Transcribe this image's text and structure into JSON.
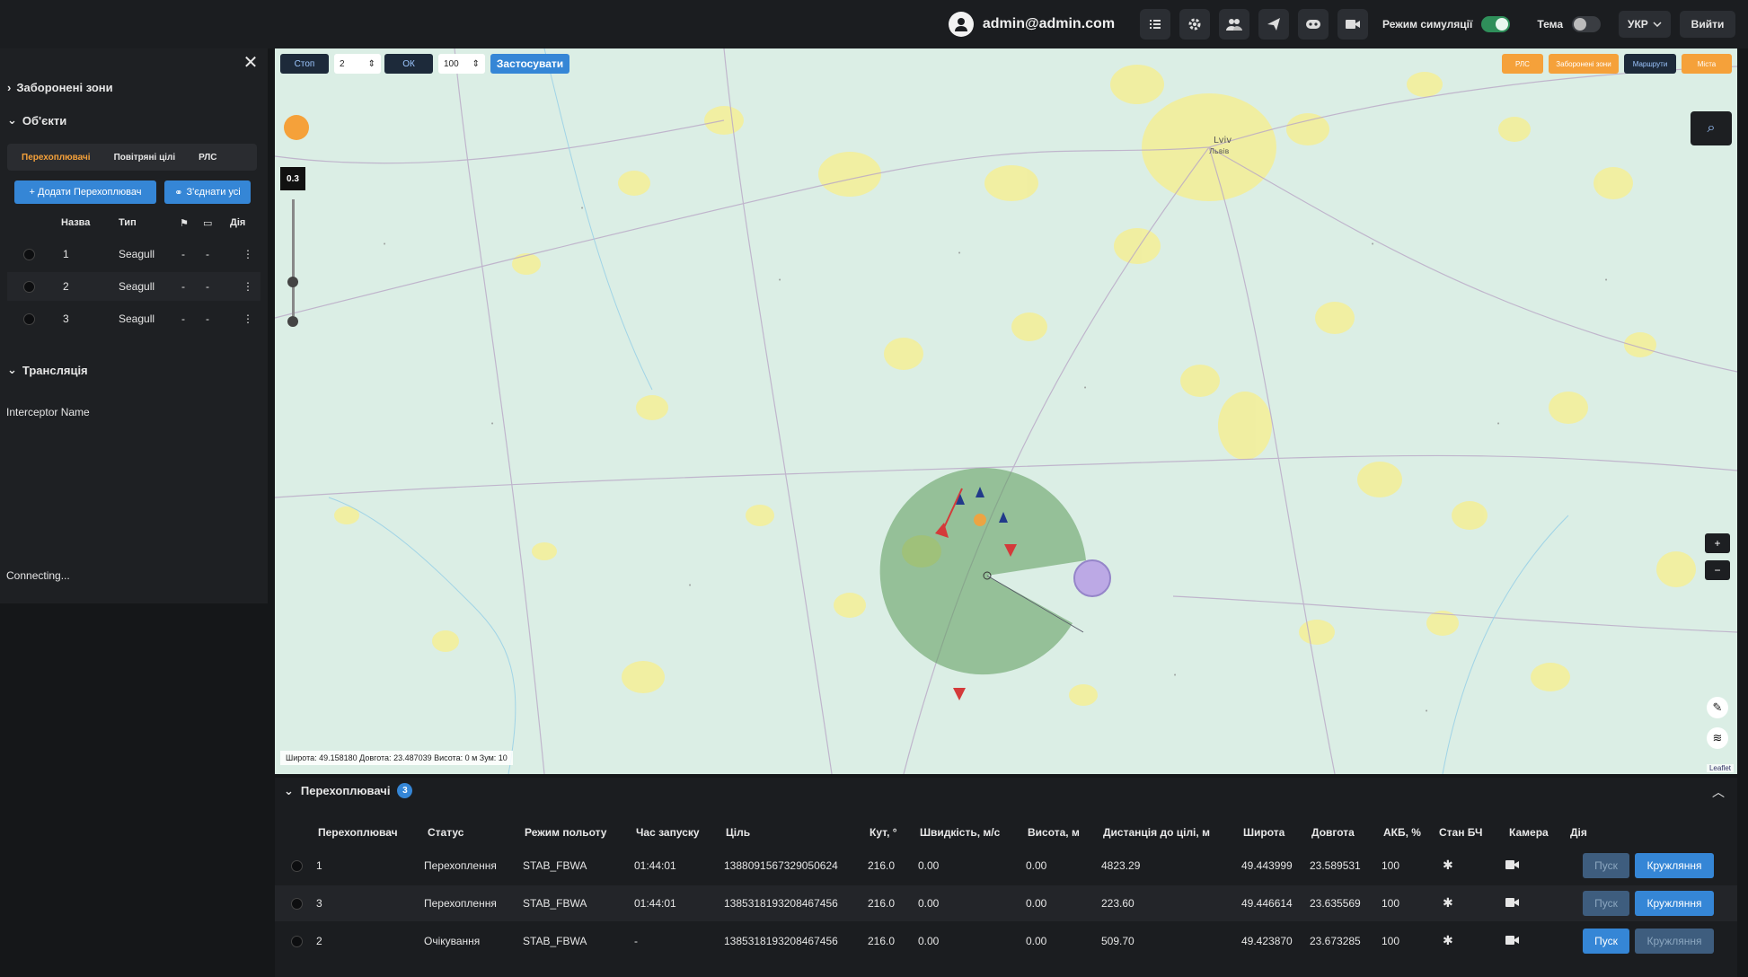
{
  "topbar": {
    "user": "admin@admin.com",
    "sim_label": "Режим симуляції",
    "theme_label": "Тема",
    "lang": "УКР",
    "logout": "Вийти"
  },
  "sidebar": {
    "sections": {
      "restricted": "Заборонені зони",
      "objects": "Об'єкти",
      "broadcast": "Трансляція"
    },
    "tabs": [
      "Перехоплювачі",
      "Повітряні цілі",
      "РЛС"
    ],
    "add_btn": "+ Додати Перехоплювач",
    "connect_btn": "З'єднати усі",
    "columns": {
      "name": "Назва",
      "type": "Тип",
      "action": "Дія"
    },
    "rows": [
      {
        "name": "1",
        "type": "Seagull",
        "c1": "-",
        "c2": "-"
      },
      {
        "name": "2",
        "type": "Seagull",
        "c1": "-",
        "c2": "-"
      },
      {
        "name": "3",
        "type": "Seagull",
        "c1": "-",
        "c2": "-"
      }
    ],
    "interceptor_name": "Interceptor Name",
    "connecting": "Connecting..."
  },
  "map": {
    "controls": {
      "stop": "Стоп",
      "speed_value": "2",
      "ok": "ОК",
      "scale_value": "100",
      "apply": "Застосувати"
    },
    "layers": [
      "РЛС",
      "Заборонені зони",
      "Маршрути",
      "Міста"
    ],
    "zoom_value": "0.3",
    "coords": "Широта: 49.158180  Довгота: 23.487039  Висота: 0 м  Зум: 10",
    "city_label": "Lviv\nЛьвів",
    "attribution": "Leaflet"
  },
  "bottom": {
    "title": "Перехоплювачі",
    "count": "3",
    "columns": [
      "Перехоплювач",
      "Статус",
      "Режим польоту",
      "Час запуску",
      "Ціль",
      "Кут, °",
      "Швидкість, м/с",
      "Висота, м",
      "Дистанція до цілі, м",
      "Широта",
      "Довгота",
      "АКБ, %",
      "Стан БЧ",
      "Камера",
      "Дія"
    ],
    "rows": [
      {
        "id": "1",
        "status": "Перехоплення",
        "mode": "STAB_FBWA",
        "launch": "01:44:01",
        "target": "1388091567329050624",
        "angle": "216.0",
        "speed": "0.00",
        "alt": "0.00",
        "dist": "4823.29",
        "lat": "49.443999",
        "lon": "23.589531",
        "bat": "100",
        "start": "Пуск",
        "loiter": "Кружляння"
      },
      {
        "id": "3",
        "status": "Перехоплення",
        "mode": "STAB_FBWA",
        "launch": "01:44:01",
        "target": "1385318193208467456",
        "angle": "216.0",
        "speed": "0.00",
        "alt": "0.00",
        "dist": "223.60",
        "lat": "49.446614",
        "lon": "23.635569",
        "bat": "100",
        "start": "Пуск",
        "loiter": "Кружляння"
      },
      {
        "id": "2",
        "status": "Очікування",
        "mode": "STAB_FBWA",
        "launch": "-",
        "target": "1385318193208467456",
        "angle": "216.0",
        "speed": "0.00",
        "alt": "0.00",
        "dist": "509.70",
        "lat": "49.423870",
        "lon": "23.673285",
        "bat": "100",
        "start": "Пуск",
        "loiter": "Кружляння"
      }
    ]
  }
}
